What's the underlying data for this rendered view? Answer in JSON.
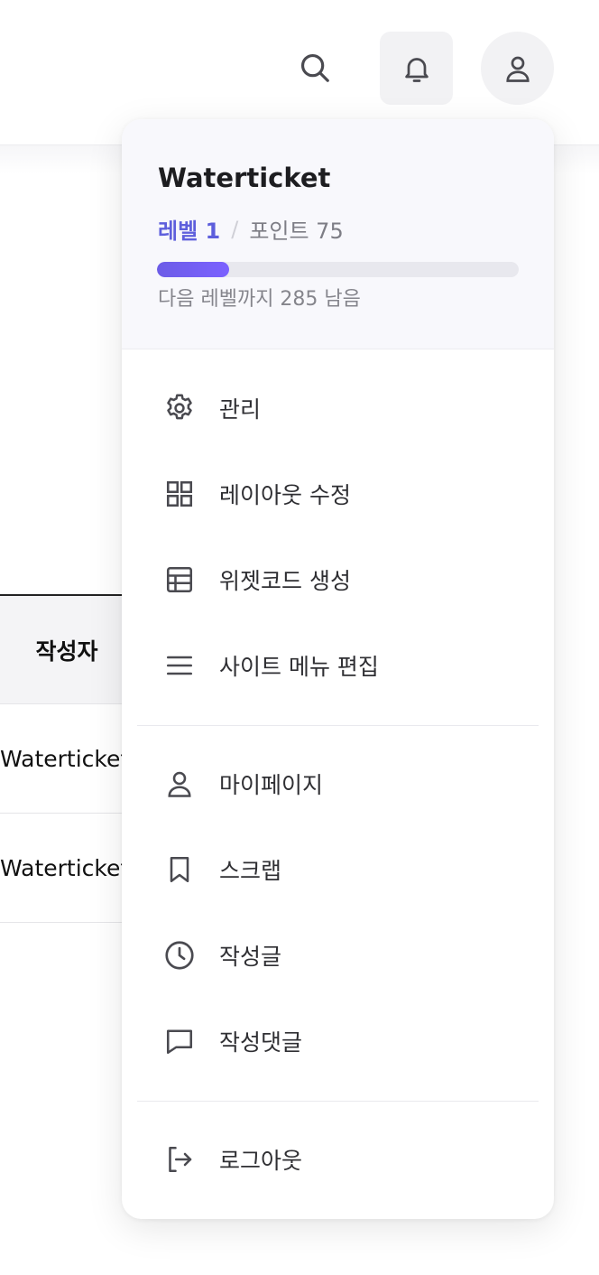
{
  "header": {
    "search_icon": "search-icon",
    "bell_icon": "bell-icon",
    "user_icon": "user-icon"
  },
  "table": {
    "header": "작성자",
    "rows": [
      "Waterticket",
      "Waterticket"
    ]
  },
  "profile": {
    "username": "Waterticket",
    "level": "레벨 1",
    "separator": "/",
    "points": "포인트 75",
    "next_level": "다음 레벨까지 285 남음",
    "progress_fraction": 0.2
  },
  "menu": {
    "group1": [
      {
        "label": "관리",
        "icon": "gear-icon"
      },
      {
        "label": "레이아웃 수정",
        "icon": "grid-icon"
      },
      {
        "label": "위젯코드 생성",
        "icon": "table-icon"
      },
      {
        "label": "사이트 메뉴 편집",
        "icon": "menu-icon"
      }
    ],
    "group2": [
      {
        "label": "마이페이지",
        "icon": "user-icon"
      },
      {
        "label": "스크랩",
        "icon": "bookmark-icon"
      },
      {
        "label": "작성글",
        "icon": "clock-icon"
      },
      {
        "label": "작성댓글",
        "icon": "comment-icon"
      }
    ],
    "group3": [
      {
        "label": "로그아웃",
        "icon": "logout-icon"
      }
    ]
  },
  "colors": {
    "accent": "#5e5fdc",
    "bar": "#6c5ce7",
    "panel_bg": "#f8f8fc"
  }
}
